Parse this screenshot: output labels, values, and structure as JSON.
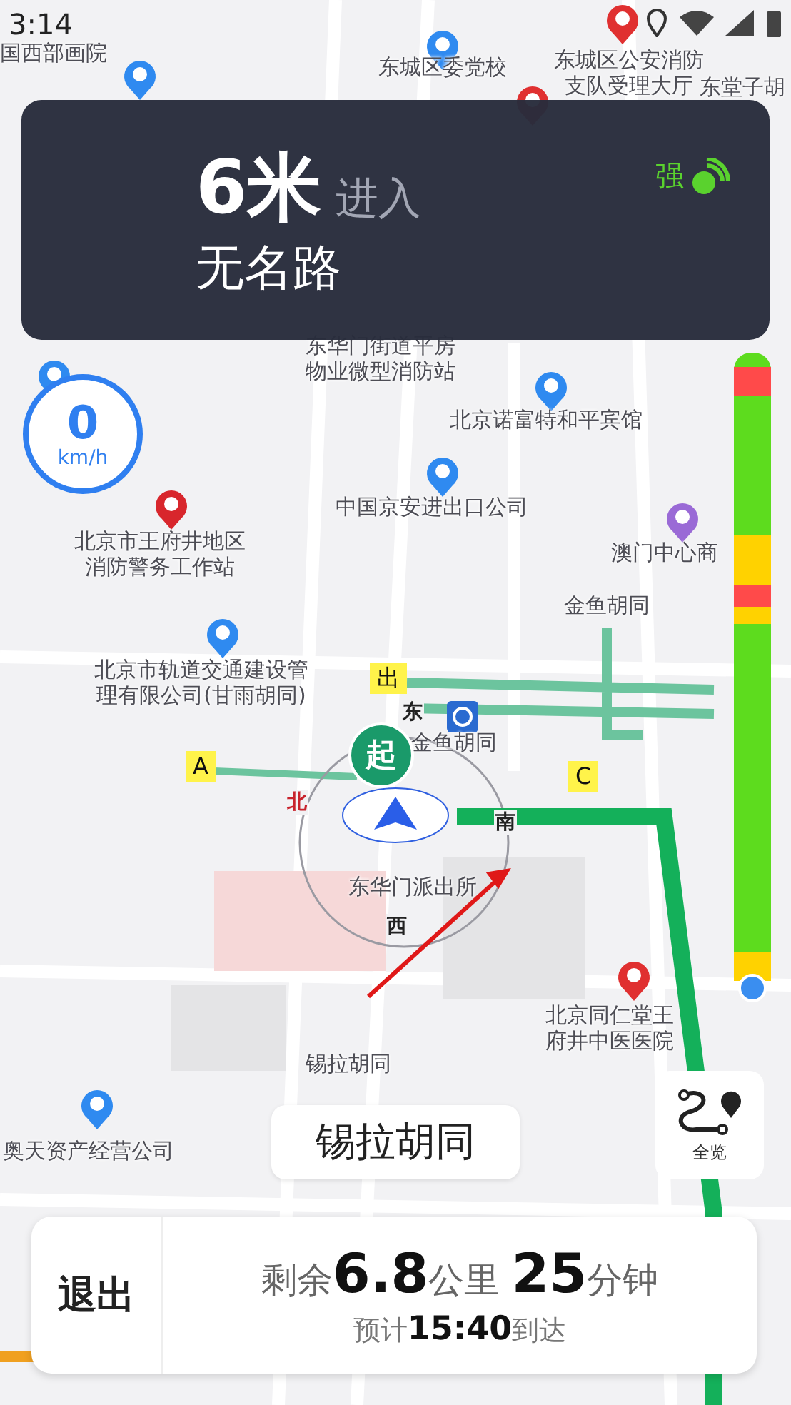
{
  "status_bar": {
    "time": "3:14"
  },
  "guidance": {
    "distance": "6米",
    "action": "进入",
    "road": "无名路",
    "signal_label": "强"
  },
  "speedometer": {
    "value": "0",
    "unit": "km/h"
  },
  "map": {
    "labels": [
      {
        "lines": [
          "国西部画院"
        ]
      },
      {
        "lines": [
          "东城区委党校"
        ]
      },
      {
        "lines": [
          "东城区公安消防",
          "支队受理大厅"
        ]
      },
      {
        "lines": [
          "东堂子胡"
        ]
      },
      {
        "lines": [
          "东华门街道平房",
          "物业微型消防站"
        ]
      },
      {
        "lines": [
          "北京诺富特和平宾馆"
        ]
      },
      {
        "lines": [
          "中国京安进出口公司"
        ]
      },
      {
        "lines": [
          "北京市王府井地区",
          "消防警务工作站"
        ]
      },
      {
        "lines": [
          "澳门中心商"
        ]
      },
      {
        "lines": [
          "金鱼胡同"
        ]
      },
      {
        "lines": [
          "北京市轨道交通建设管",
          "理有限公司(甘雨胡同)"
        ]
      },
      {
        "lines": [
          "金鱼胡同"
        ]
      },
      {
        "lines": [
          "东华门派出所"
        ]
      },
      {
        "lines": [
          "北京同仁堂王",
          "府井中医医院"
        ]
      },
      {
        "lines": [
          "锡拉胡同"
        ]
      },
      {
        "lines": [
          "奥天资产经营公司"
        ]
      }
    ],
    "exit_tags": [
      "出",
      "A",
      "C"
    ],
    "start_marker": "起",
    "compass": [
      "北",
      "东",
      "南",
      "西"
    ]
  },
  "current_road": "锡拉胡同",
  "overview_button": {
    "label": "全览"
  },
  "trip": {
    "exit_button": "退出",
    "remaining": "剩余**6.8**公里 **25**分钟",
    "arrival": "预计**15:40**到达"
  }
}
